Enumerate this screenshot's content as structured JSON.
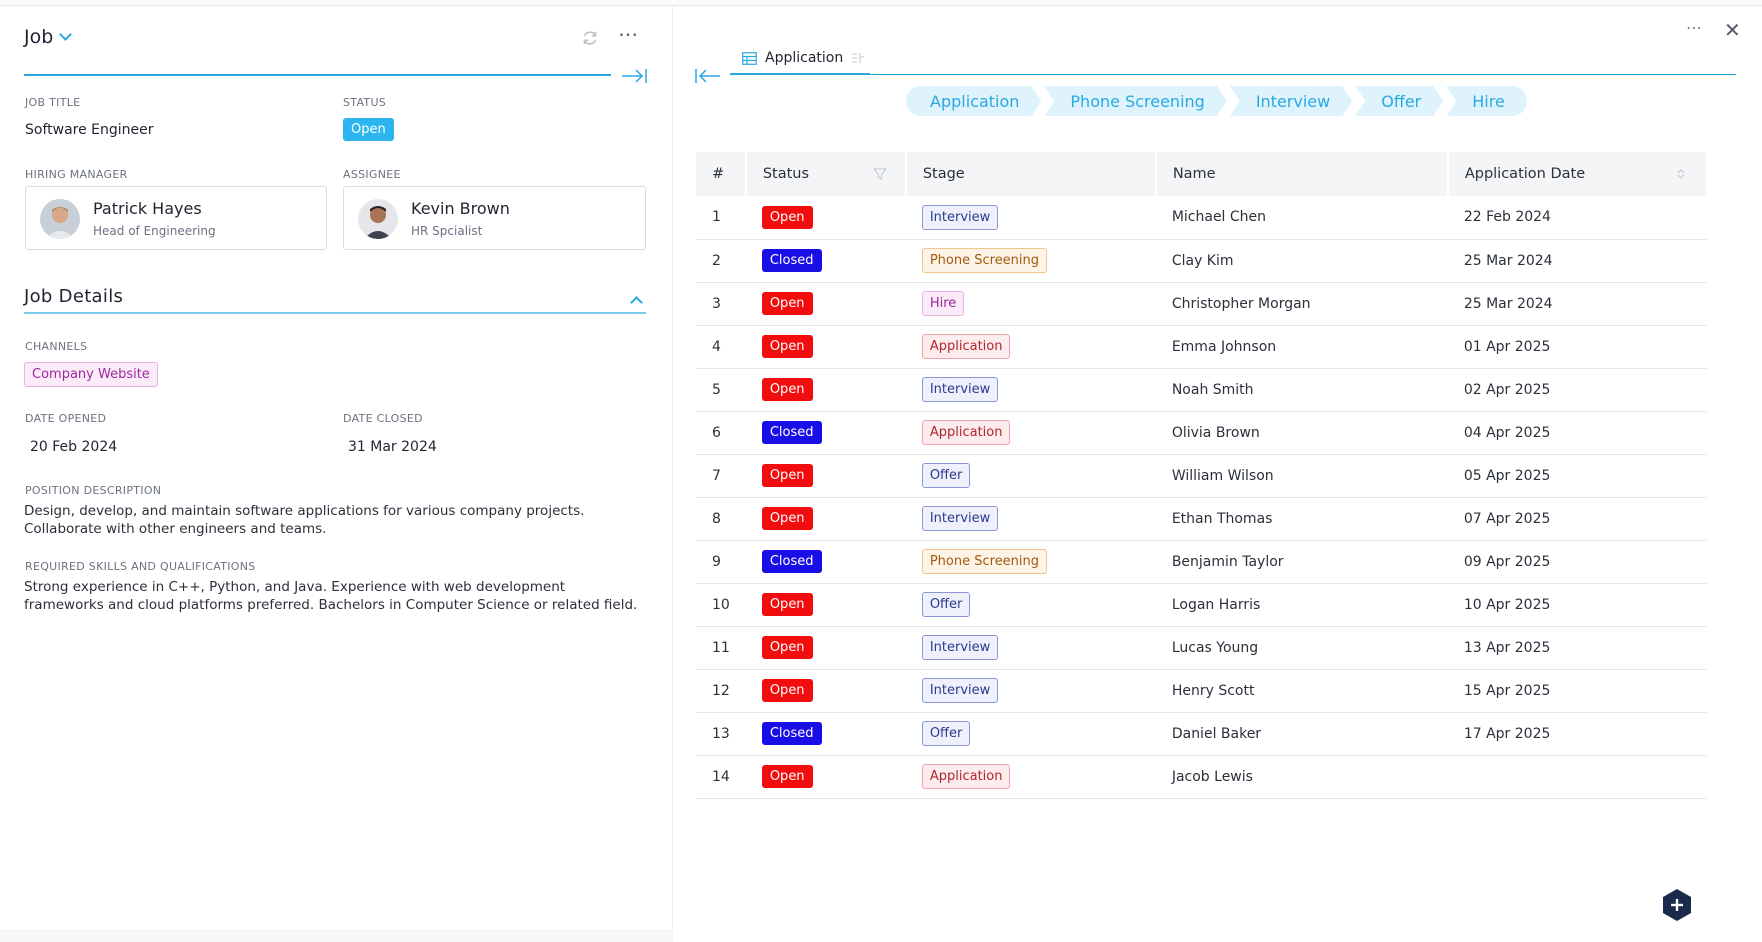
{
  "job_panel": {
    "title": "Job",
    "job_title_label": "JOB TITLE",
    "job_title": "Software Engineer",
    "status_label": "STATUS",
    "status": "Open",
    "hiring_manager_label": "HIRING MANAGER",
    "hiring_manager": {
      "name": "Patrick Hayes",
      "role": "Head of Engineering"
    },
    "assignee_label": "ASSIGNEE",
    "assignee": {
      "name": "Kevin Brown",
      "role": "HR Spcialist"
    },
    "details_title": "Job Details",
    "channels_label": "CHANNELS",
    "channel": "Company Website",
    "date_opened_label": "DATE OPENED",
    "date_opened": "20 Feb 2024",
    "date_closed_label": "DATE CLOSED",
    "date_closed": "31 Mar 2024",
    "position_description_label": "POSITION DESCRIPTION",
    "position_description": "Design, develop, and maintain software applications for various company projects. Collaborate with other engineers and teams.",
    "skills_label": "REQUIRED SKILLS AND QUALIFICATIONS",
    "skills": "Strong experience in C++, Python, and Java. Experience with web development frameworks and cloud platforms preferred. Bachelors in Computer Science or related field."
  },
  "right_panel": {
    "tab_label": "Application",
    "pipeline": [
      "Application",
      "Phone Screening",
      "Interview",
      "Offer",
      "Hire"
    ],
    "columns": [
      "#",
      "Status",
      "Stage",
      "Name",
      "Application Date"
    ],
    "rows": [
      {
        "n": "1",
        "status": "Open",
        "stage": "Interview",
        "name": "Michael Chen",
        "date": "22 Feb 2024"
      },
      {
        "n": "2",
        "status": "Closed",
        "stage": "Phone Screening",
        "name": "Clay Kim",
        "date": "25 Mar 2024"
      },
      {
        "n": "3",
        "status": "Open",
        "stage": "Hire",
        "name": "Christopher Morgan",
        "date": "25 Mar 2024"
      },
      {
        "n": "4",
        "status": "Open",
        "stage": "Application",
        "name": "Emma Johnson",
        "date": "01 Apr 2025"
      },
      {
        "n": "5",
        "status": "Open",
        "stage": "Interview",
        "name": "Noah Smith",
        "date": "02 Apr 2025"
      },
      {
        "n": "6",
        "status": "Closed",
        "stage": "Application",
        "name": "Olivia Brown",
        "date": "04 Apr 2025"
      },
      {
        "n": "7",
        "status": "Open",
        "stage": "Offer",
        "name": "William Wilson",
        "date": "05 Apr 2025"
      },
      {
        "n": "8",
        "status": "Open",
        "stage": "Interview",
        "name": "Ethan Thomas",
        "date": "07 Apr 2025"
      },
      {
        "n": "9",
        "status": "Closed",
        "stage": "Phone Screening",
        "name": "Benjamin Taylor",
        "date": "09 Apr 2025"
      },
      {
        "n": "10",
        "status": "Open",
        "stage": "Offer",
        "name": "Logan Harris",
        "date": "10 Apr 2025"
      },
      {
        "n": "11",
        "status": "Open",
        "stage": "Interview",
        "name": "Lucas Young",
        "date": "13 Apr 2025"
      },
      {
        "n": "12",
        "status": "Open",
        "stage": "Interview",
        "name": "Henry Scott",
        "date": "15 Apr 2025"
      },
      {
        "n": "13",
        "status": "Closed",
        "stage": "Offer",
        "name": "Daniel Baker",
        "date": "17 Apr 2025"
      },
      {
        "n": "14",
        "status": "Open",
        "stage": "Application",
        "name": "Jacob Lewis",
        "date": ""
      }
    ]
  },
  "colors": {
    "accent": "#2aa9e0",
    "status_open": "#f10d0d",
    "status_closed": "#1a0ee6",
    "stage_interview": {
      "bg": "#eef0fb",
      "fg": "#2b3a8f",
      "border": "#8d97d8"
    },
    "stage_phone": {
      "bg": "#fdf3e6",
      "fg": "#a25a10",
      "border": "#f0c48a"
    },
    "stage_hire": {
      "bg": "#fbeaf7",
      "fg": "#9b2aa0",
      "border": "#e6b3e2"
    },
    "stage_application": {
      "bg": "#fdeced",
      "fg": "#b0262e",
      "border": "#f1a5aa"
    },
    "stage_offer": {
      "bg": "#eef0fb",
      "fg": "#2b3a8f",
      "border": "#8d97d8"
    }
  }
}
